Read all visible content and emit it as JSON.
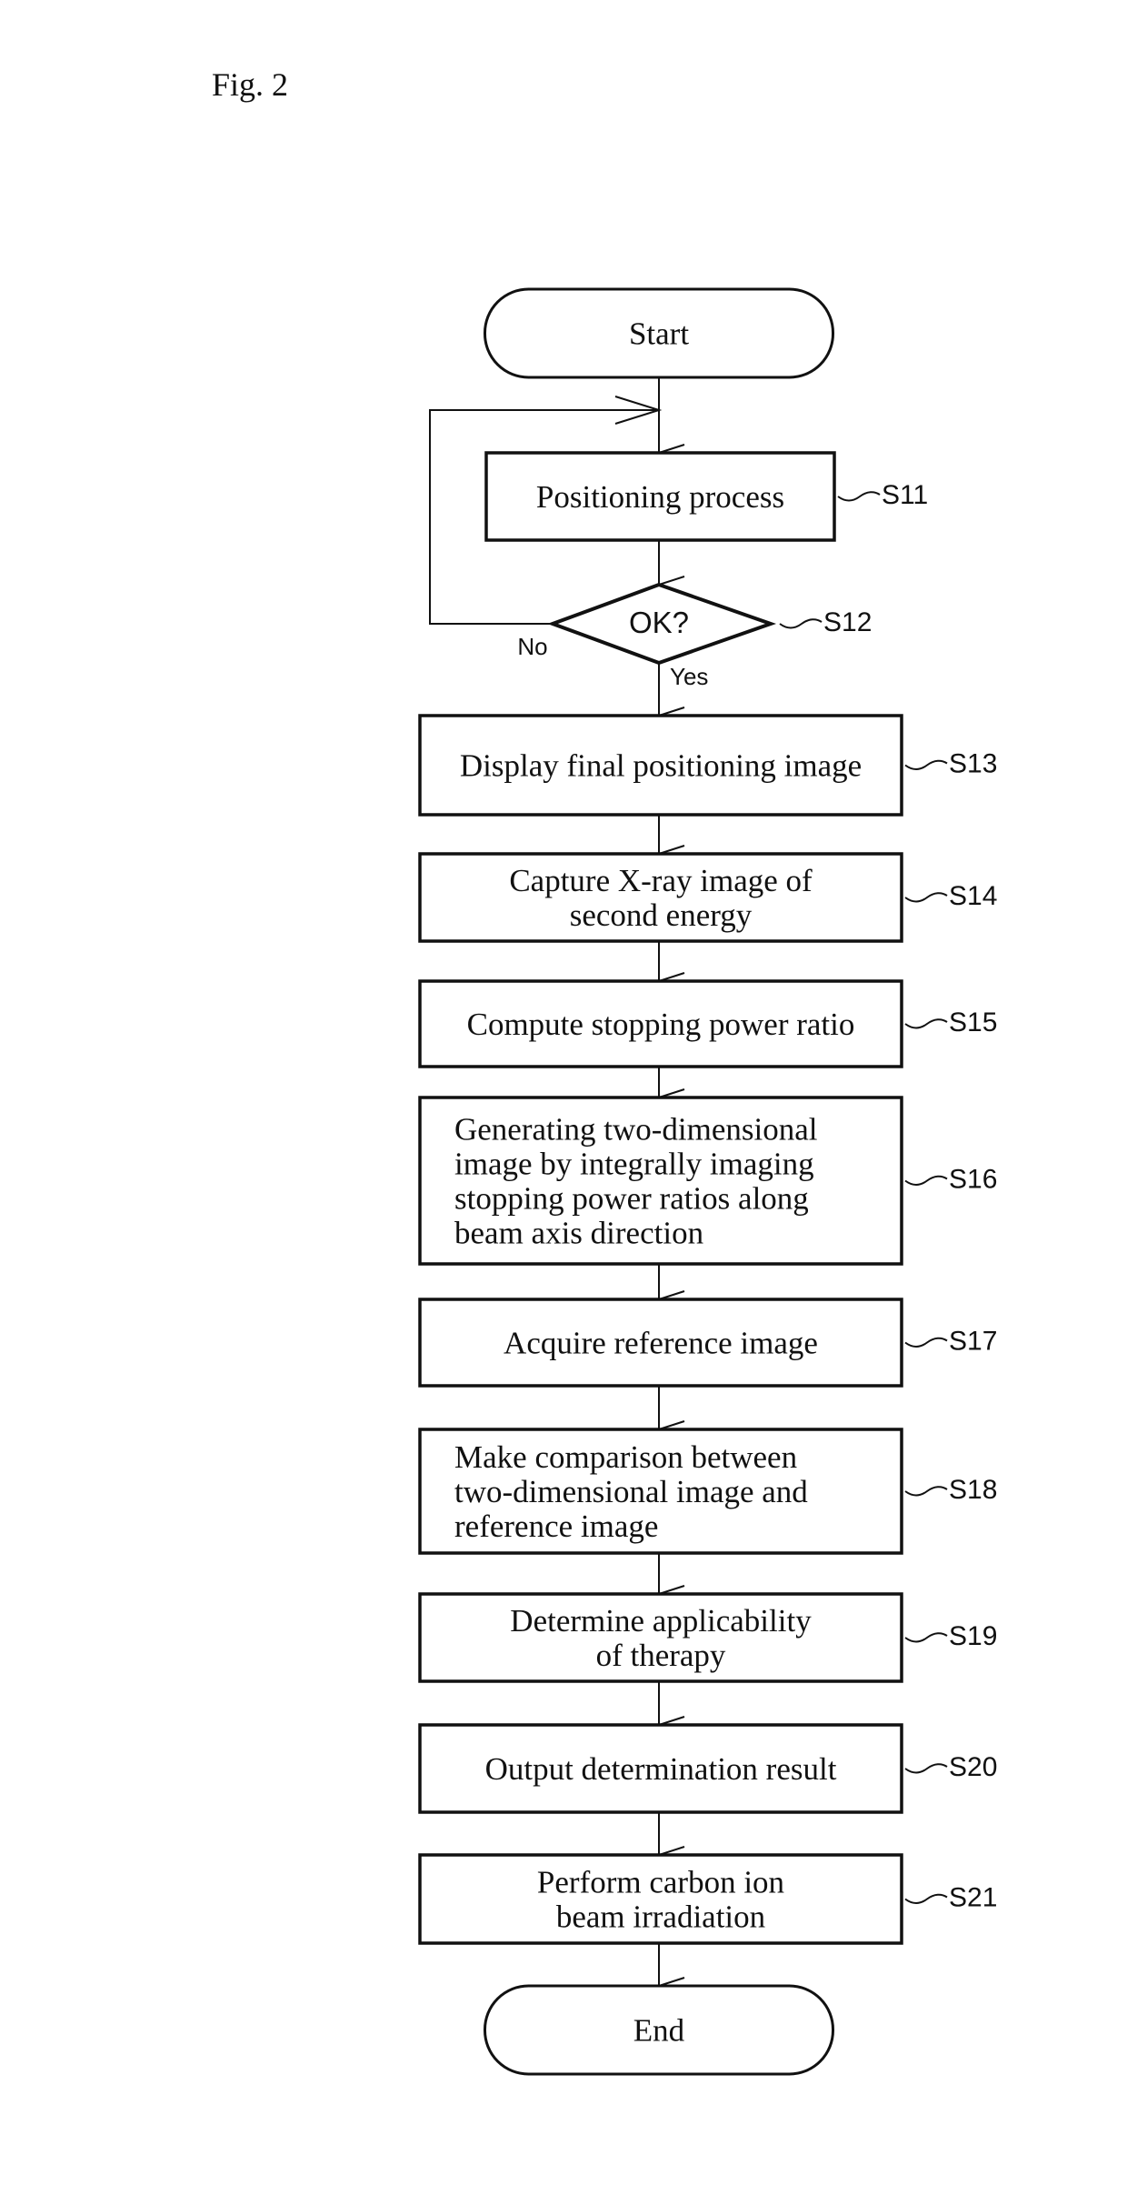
{
  "figure": {
    "label": "Fig. 2"
  },
  "flowchart": {
    "start": {
      "label": "Start"
    },
    "end": {
      "label": "End"
    },
    "steps": [
      {
        "id": "S11",
        "type": "process",
        "lines": [
          "Positioning process"
        ],
        "align": "center"
      },
      {
        "id": "S12",
        "type": "decision",
        "lines": [
          "OK?"
        ],
        "yes": "Yes",
        "no": "No"
      },
      {
        "id": "S13",
        "type": "process",
        "lines": [
          "Display final positioning image"
        ],
        "align": "center"
      },
      {
        "id": "S14",
        "type": "process",
        "lines": [
          "Capture X-ray image of",
          "second energy"
        ],
        "align": "center"
      },
      {
        "id": "S15",
        "type": "process",
        "lines": [
          "Compute stopping power ratio"
        ],
        "align": "center"
      },
      {
        "id": "S16",
        "type": "process",
        "lines": [
          "Generating two-dimensional",
          "image by integrally imaging",
          "stopping power ratios along",
          "beam axis direction"
        ],
        "align": "left"
      },
      {
        "id": "S17",
        "type": "process",
        "lines": [
          "Acquire reference image"
        ],
        "align": "center"
      },
      {
        "id": "S18",
        "type": "process",
        "lines": [
          "Make comparison between",
          "two-dimensional image and",
          "reference image"
        ],
        "align": "left"
      },
      {
        "id": "S19",
        "type": "process",
        "lines": [
          "Determine applicability",
          "of therapy"
        ],
        "align": "center"
      },
      {
        "id": "S20",
        "type": "process",
        "lines": [
          "Output determination result"
        ],
        "align": "center"
      },
      {
        "id": "S21",
        "type": "process",
        "lines": [
          "Perform carbon ion",
          "beam irradiation"
        ],
        "align": "center"
      }
    ],
    "loop": {
      "from": "S12",
      "to": "S11",
      "condition": "No"
    }
  }
}
